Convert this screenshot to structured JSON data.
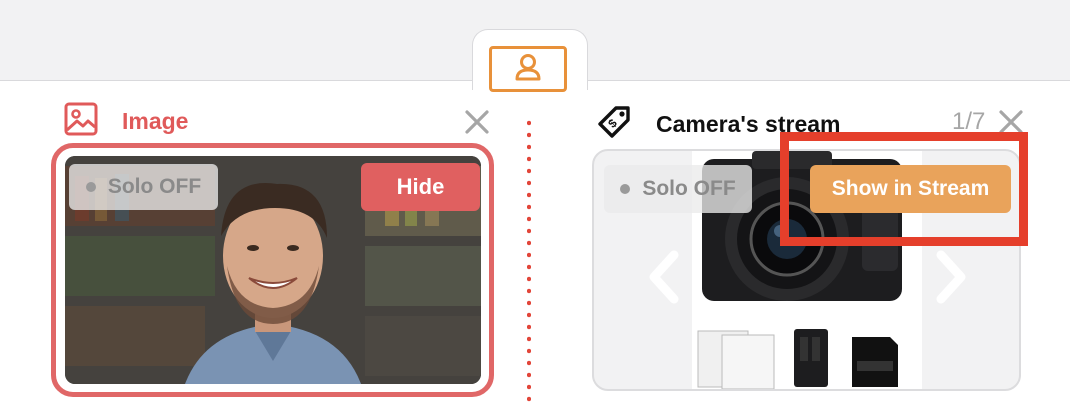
{
  "colors": {
    "accent_orange": "#e8913a",
    "image_red": "#e06767",
    "highlight_red": "#e53f2b",
    "stream_button": "#e9a35b"
  },
  "avatar_tab": {
    "icon": "user-icon"
  },
  "left_panel": {
    "icon": "image-icon",
    "title": "Image",
    "close_icon": "close-icon",
    "solo_label": "Solo OFF",
    "hide_label": "Hide"
  },
  "right_panel": {
    "icon": "tag-icon",
    "title": "Camera's stream",
    "counter": "1/7",
    "close_icon": "close-icon",
    "solo_label": "Solo OFF",
    "show_label": "Show in Stream",
    "prev_icon": "chevron-left-icon",
    "next_icon": "chevron-right-icon"
  }
}
